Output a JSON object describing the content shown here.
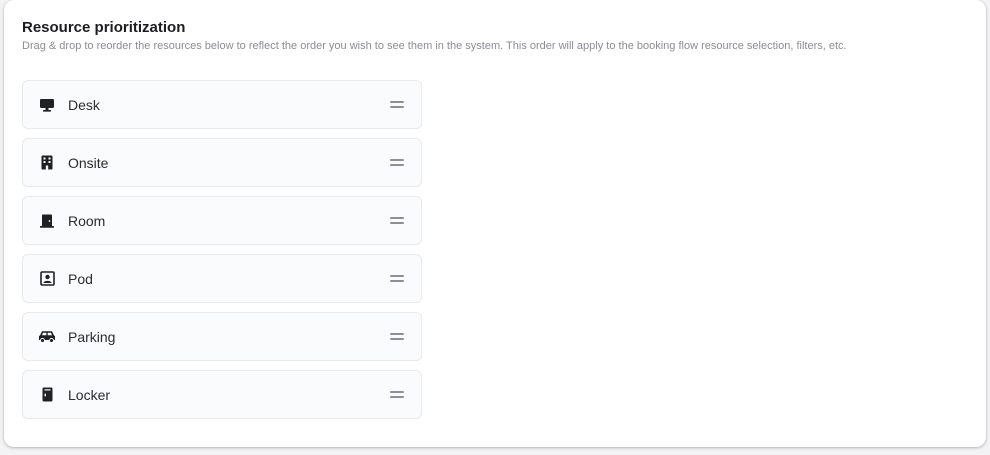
{
  "header": {
    "title": "Resource prioritization",
    "description": "Drag & drop to reorder the resources below to reflect the order you wish to see them in the system. This order will apply to the booking flow resource selection, filters, etc."
  },
  "resources": [
    {
      "label": "Desk",
      "icon": "desk-monitor-icon"
    },
    {
      "label": "Onsite",
      "icon": "building-icon"
    },
    {
      "label": "Room",
      "icon": "door-icon"
    },
    {
      "label": "Pod",
      "icon": "pod-person-icon"
    },
    {
      "label": "Parking",
      "icon": "car-icon"
    },
    {
      "label": "Locker",
      "icon": "locker-icon"
    }
  ]
}
